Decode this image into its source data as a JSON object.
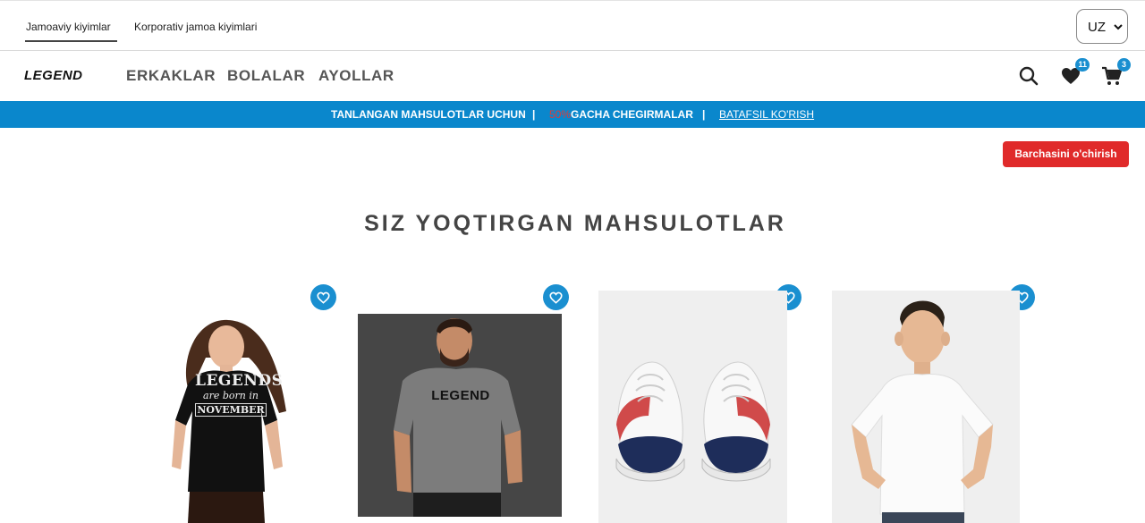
{
  "topbar": {
    "links": [
      "Jamoaviy kiyimlar",
      "Korporativ jamoa kiyimlari"
    ],
    "language": "UZ"
  },
  "nav": {
    "logo": "LEGEND",
    "items": [
      "ERKAKLAR",
      "BOLALAR",
      "AYOLLAR"
    ],
    "wishlist_count": "11",
    "cart_count": "3"
  },
  "promo": {
    "text1": "TANLANGAN MAHSULOTLAR UCHUN",
    "separator": "|",
    "percent": "50%",
    "text2": "GACHA CHEGIRMALAR",
    "link": "BATAFSIL KO'RISH"
  },
  "main": {
    "clear_all": "Barchasini o'chirish",
    "title": "SIZ YOQTIRGAN MAHSULOTLAR"
  },
  "products": [
    {
      "image": "women-black-tshirt",
      "print": [
        "LEGENDS",
        "are born in",
        "NOVEMBER"
      ]
    },
    {
      "image": "men-gray-tshirt",
      "print": [
        "LEGEND"
      ]
    },
    {
      "image": "sneakers-pair",
      "print": []
    },
    {
      "image": "boy-white-tshirt",
      "print": []
    }
  ],
  "colors": {
    "accent": "#0a87cc",
    "badge": "#1a8fd0",
    "danger": "#e02a2a"
  }
}
